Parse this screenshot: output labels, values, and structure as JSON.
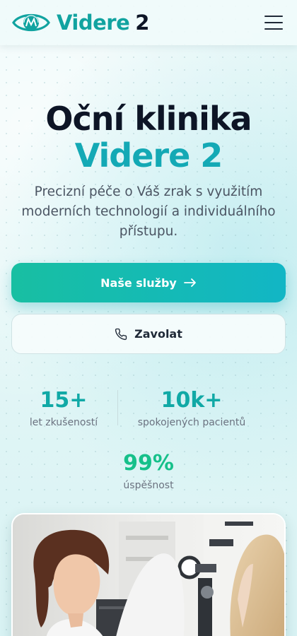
{
  "header": {
    "brand_name": "Videre",
    "brand_number": "2",
    "logo_icon": "eye-logo-icon",
    "menu_icon": "hamburger-menu-icon"
  },
  "hero": {
    "title_line1": "Oční klinika",
    "title_line2": "Videre 2",
    "subtitle": "Precizní péče o Váš zrak s využitím moderních technologií a individuálního přístupu."
  },
  "buttons": {
    "primary_label": "Naše služby",
    "primary_icon": "arrow-right-icon",
    "secondary_label": "Zavolat",
    "secondary_icon": "phone-icon"
  },
  "stats": [
    {
      "value": "15+",
      "label": "let zkušeností"
    },
    {
      "value": "10k+",
      "label": "spokojených pacientů"
    },
    {
      "value": "99%",
      "label": "úspěšnost"
    }
  ],
  "colors": {
    "accent": "#11a3a0",
    "accent_cyan": "#14a9b5",
    "accent_green": "#16c08a",
    "dark": "#0d1526"
  }
}
